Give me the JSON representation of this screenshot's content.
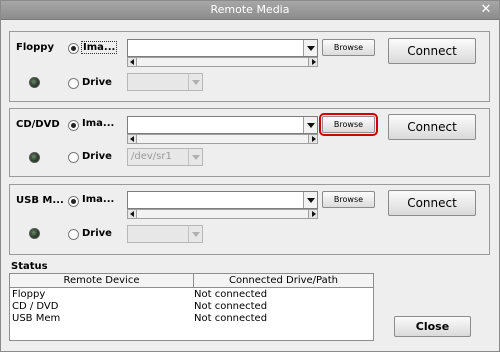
{
  "window": {
    "title": "Remote Media",
    "close_glyph": "✕"
  },
  "floppy": {
    "title": "Floppy",
    "image_label": "Ima...",
    "drive_label": "Drive",
    "browse_label": "Browse",
    "connect_label": "Connect",
    "drive_value": ""
  },
  "cddvd": {
    "title": "CD/DVD",
    "image_label": "Ima...",
    "drive_label": "Drive",
    "browse_label": "Browse",
    "connect_label": "Connect",
    "drive_value": "/dev/sr1"
  },
  "usb": {
    "title": "USB M...",
    "image_label": "Ima...",
    "drive_label": "Drive",
    "browse_label": "Browse",
    "connect_label": "Connect",
    "drive_value": ""
  },
  "status": {
    "title": "Status",
    "columns": [
      "Remote Device",
      "Connected Drive/Path"
    ],
    "rows": [
      [
        "Floppy",
        "Not connected"
      ],
      [
        "CD / DVD",
        "Not connected"
      ],
      [
        "USB Mem",
        "Not connected"
      ]
    ]
  },
  "footer": {
    "close_label": "Close"
  },
  "colors": {
    "highlight": "#d00000",
    "titlebar": "#9a9a9a"
  },
  "icons": {
    "status_led": "led-icon",
    "dropdown": "chevron-down-icon"
  }
}
